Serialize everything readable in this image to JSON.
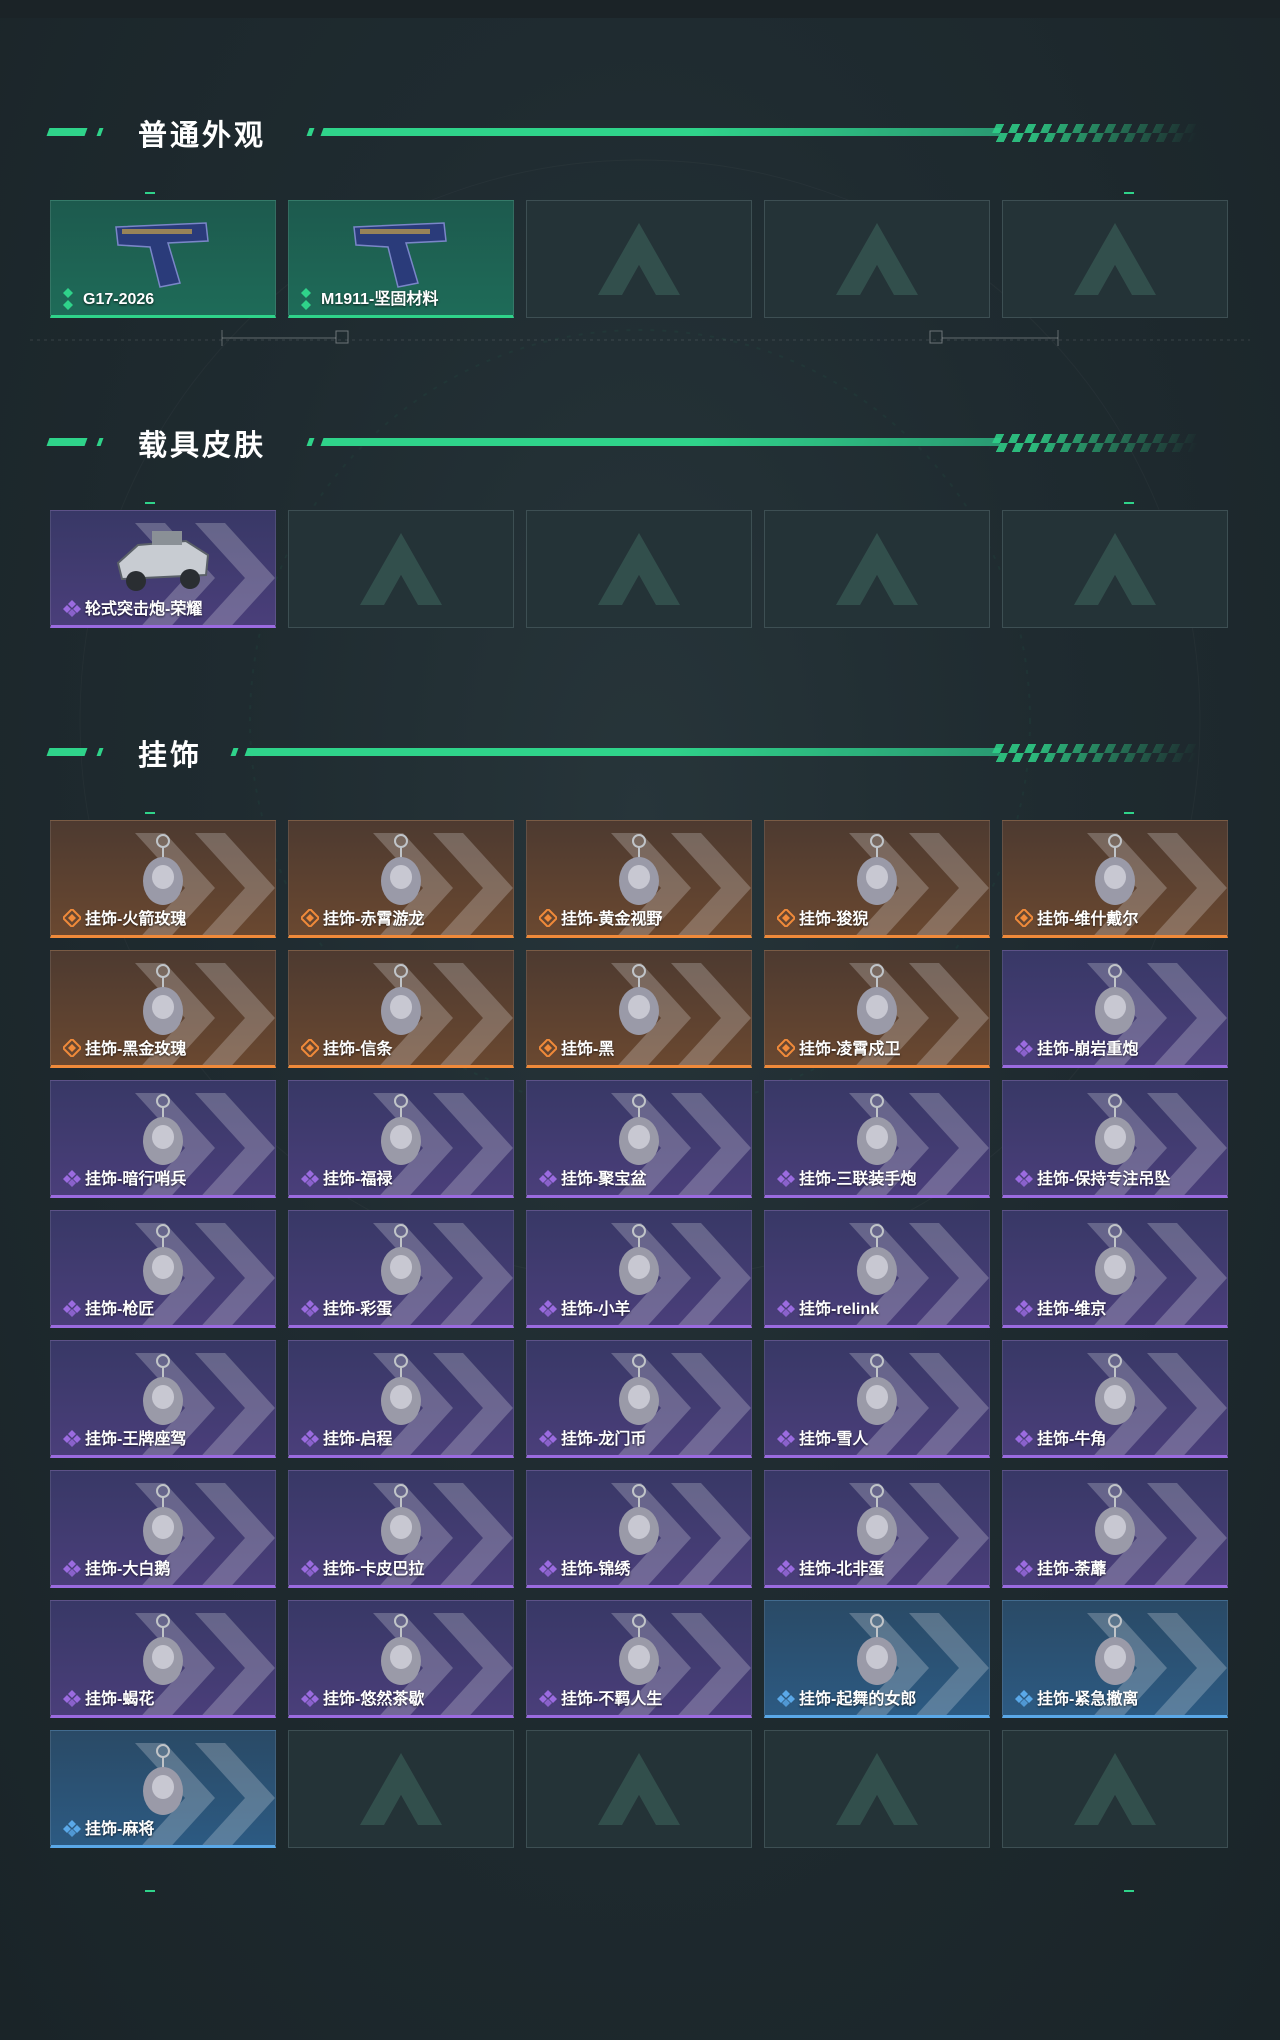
{
  "sections": {
    "skins": {
      "title": "普通外观",
      "items": [
        {
          "label": "G17-2026",
          "rarity": "green",
          "icon": "pistol-icon"
        },
        {
          "label": "M1911-坚固材料",
          "rarity": "green",
          "icon": "pistol-icon"
        },
        {
          "empty": true
        },
        {
          "empty": true
        },
        {
          "empty": true
        }
      ]
    },
    "vehicles": {
      "title": "载具皮肤",
      "items": [
        {
          "label": "轮式突击炮-荣耀",
          "rarity": "purple",
          "icon": "vehicle-icon"
        },
        {
          "empty": true
        },
        {
          "empty": true
        },
        {
          "empty": true
        },
        {
          "empty": true
        }
      ]
    },
    "charms": {
      "title": "挂饰",
      "items": [
        {
          "label": "挂饰-火箭玫瑰",
          "rarity": "orange",
          "icon": "charm-icon"
        },
        {
          "label": "挂饰-赤霄游龙",
          "rarity": "orange",
          "icon": "charm-icon"
        },
        {
          "label": "挂饰-黄金视野",
          "rarity": "orange",
          "icon": "charm-icon"
        },
        {
          "label": "挂饰-狻猊",
          "rarity": "orange",
          "icon": "charm-icon"
        },
        {
          "label": "挂饰-维什戴尔",
          "rarity": "orange",
          "icon": "charm-icon"
        },
        {
          "label": "挂饰-黑金玫瑰",
          "rarity": "orange",
          "icon": "charm-icon"
        },
        {
          "label": "挂饰-信条",
          "rarity": "orange",
          "icon": "charm-icon"
        },
        {
          "label": "挂饰-黑",
          "rarity": "orange",
          "icon": "charm-icon"
        },
        {
          "label": "挂饰-凌霄戍卫",
          "rarity": "orange",
          "icon": "charm-icon"
        },
        {
          "label": "挂饰-崩岩重炮",
          "rarity": "purple",
          "icon": "charm-icon"
        },
        {
          "label": "挂饰-暗行哨兵",
          "rarity": "purple",
          "icon": "charm-icon"
        },
        {
          "label": "挂饰-福禄",
          "rarity": "purple",
          "icon": "charm-icon"
        },
        {
          "label": "挂饰-聚宝盆",
          "rarity": "purple",
          "icon": "charm-icon"
        },
        {
          "label": "挂饰-三联装手炮",
          "rarity": "purple",
          "icon": "charm-icon"
        },
        {
          "label": "挂饰-保持专注吊坠",
          "rarity": "purple",
          "icon": "charm-icon"
        },
        {
          "label": "挂饰-枪匠",
          "rarity": "purple",
          "icon": "charm-icon"
        },
        {
          "label": "挂饰-彩蛋",
          "rarity": "purple",
          "icon": "charm-icon"
        },
        {
          "label": "挂饰-小羊",
          "rarity": "purple",
          "icon": "charm-icon"
        },
        {
          "label": "挂饰-relink",
          "rarity": "purple",
          "icon": "charm-icon"
        },
        {
          "label": "挂饰-维京",
          "rarity": "purple",
          "icon": "charm-icon"
        },
        {
          "label": "挂饰-王牌座驾",
          "rarity": "purple",
          "icon": "charm-icon"
        },
        {
          "label": "挂饰-启程",
          "rarity": "purple",
          "icon": "charm-icon"
        },
        {
          "label": "挂饰-龙门币",
          "rarity": "purple",
          "icon": "charm-icon"
        },
        {
          "label": "挂饰-雪人",
          "rarity": "purple",
          "icon": "charm-icon"
        },
        {
          "label": "挂饰-牛角",
          "rarity": "purple",
          "icon": "charm-icon"
        },
        {
          "label": "挂饰-大白鹅",
          "rarity": "purple",
          "icon": "charm-icon"
        },
        {
          "label": "挂饰-卡皮巴拉",
          "rarity": "purple",
          "icon": "charm-icon"
        },
        {
          "label": "挂饰-锦绣",
          "rarity": "purple",
          "icon": "charm-icon"
        },
        {
          "label": "挂饰-北非蛋",
          "rarity": "purple",
          "icon": "charm-icon"
        },
        {
          "label": "挂饰-荼蘼",
          "rarity": "purple",
          "icon": "charm-icon"
        },
        {
          "label": "挂饰-蝎花",
          "rarity": "purple",
          "icon": "charm-icon"
        },
        {
          "label": "挂饰-悠然茶歇",
          "rarity": "purple",
          "icon": "charm-icon"
        },
        {
          "label": "挂饰-不羁人生",
          "rarity": "purple",
          "icon": "charm-icon"
        },
        {
          "label": "挂饰-起舞的女郎",
          "rarity": "blue",
          "icon": "charm-icon"
        },
        {
          "label": "挂饰-紧急撤离",
          "rarity": "blue",
          "icon": "charm-icon"
        },
        {
          "label": "挂饰-麻将",
          "rarity": "blue",
          "icon": "charm-icon"
        },
        {
          "empty": true
        },
        {
          "empty": true
        },
        {
          "empty": true
        },
        {
          "empty": true
        }
      ]
    }
  },
  "colors": {
    "accent": "#2fd38a",
    "green": "#2fd38a",
    "orange": "#f08a3a",
    "purple": "#9b6be0",
    "blue": "#5aa8e8"
  }
}
